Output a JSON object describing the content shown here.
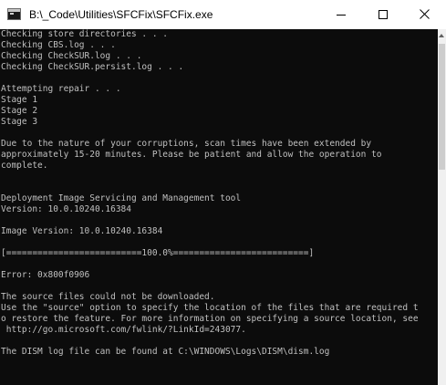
{
  "window": {
    "title": "B:\\_Code\\Utilities\\SFCFix\\SFCFix.exe"
  },
  "title_buttons": {
    "minimize_icon": "minimize-icon",
    "maximize_icon": "maximize-icon",
    "close_icon": "close-icon"
  },
  "colors": {
    "console_background": "#0c0c0c",
    "console_text": "#c0c0c0",
    "titlebar_background": "#ffffff"
  },
  "console": {
    "lines": [
      "Checking store directories . . .",
      "Checking CBS.log . . .",
      "Checking CheckSUR.log . . .",
      "Checking CheckSUR.persist.log . . .",
      "",
      "Attempting repair . . .",
      "Stage 1",
      "Stage 2",
      "Stage 3",
      "",
      "Due to the nature of your corruptions, scan times have been extended by",
      "approximately 15-20 minutes. Please be patient and allow the operation to",
      "complete.",
      "",
      "",
      "Deployment Image Servicing and Management tool",
      "Version: 10.0.10240.16384",
      "",
      "Image Version: 10.0.10240.16384",
      "",
      "[==========================100.0%==========================]",
      "",
      "Error: 0x800f0906",
      "",
      "The source files could not be downloaded.",
      "Use the \"source\" option to specify the location of the files that are required t",
      "o restore the feature. For more information on specifying a source location, see",
      " http://go.microsoft.com/fwlink/?LinkId=243077.",
      "",
      "The DISM log file can be found at C:\\WINDOWS\\Logs\\DISM\\dism.log"
    ]
  }
}
